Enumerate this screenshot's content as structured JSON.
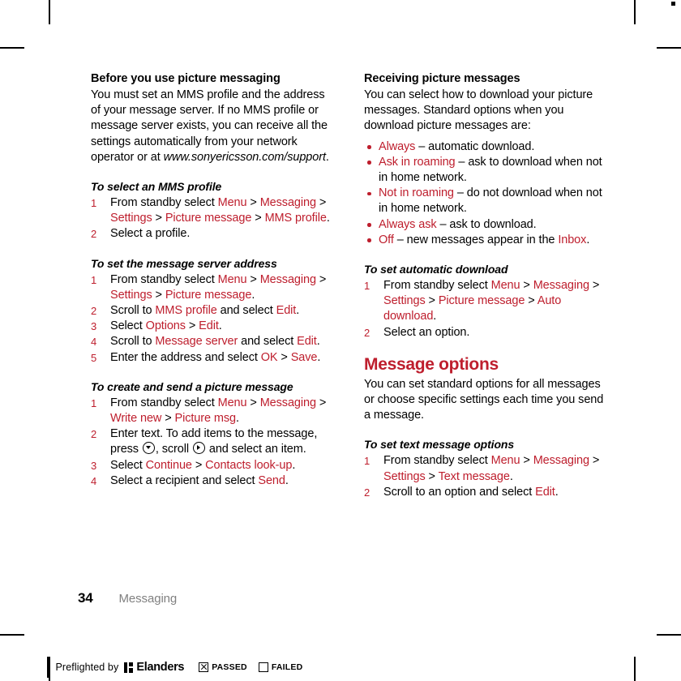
{
  "page": {
    "folio": "34",
    "section_label": "Messaging"
  },
  "left_column": {
    "intro": {
      "heading": "Before you use picture messaging",
      "body_prefix": "You must set an MMS profile and the address of your message server. If no MMS profile or message server exists, you can receive all the settings automatically from your network operator or at ",
      "body_url": "www.sonyericsson.com/support",
      "body_suffix": "."
    },
    "procedures": [
      {
        "title": "To select an MMS profile",
        "steps": [
          {
            "num": "1",
            "parts": [
              {
                "t": "From standby select ",
                "k": false
              },
              {
                "t": "Menu",
                "k": true
              },
              {
                "t": " > ",
                "k": false
              },
              {
                "t": "Messaging",
                "k": true
              },
              {
                "t": " > ",
                "k": false
              },
              {
                "t": "Settings",
                "k": true
              },
              {
                "t": " > ",
                "k": false
              },
              {
                "t": "Picture message",
                "k": true
              },
              {
                "t": " > ",
                "k": false
              },
              {
                "t": "MMS profile",
                "k": true
              },
              {
                "t": ".",
                "k": false
              }
            ]
          },
          {
            "num": "2",
            "parts": [
              {
                "t": "Select a profile.",
                "k": false
              }
            ]
          }
        ]
      },
      {
        "title": "To set the message server address",
        "steps": [
          {
            "num": "1",
            "parts": [
              {
                "t": "From standby select ",
                "k": false
              },
              {
                "t": "Menu",
                "k": true
              },
              {
                "t": " > ",
                "k": false
              },
              {
                "t": "Messaging",
                "k": true
              },
              {
                "t": " > ",
                "k": false
              },
              {
                "t": "Settings",
                "k": true
              },
              {
                "t": " > ",
                "k": false
              },
              {
                "t": "Picture message",
                "k": true
              },
              {
                "t": ".",
                "k": false
              }
            ]
          },
          {
            "num": "2",
            "parts": [
              {
                "t": "Scroll to ",
                "k": false
              },
              {
                "t": "MMS profile",
                "k": true
              },
              {
                "t": " and select ",
                "k": false
              },
              {
                "t": "Edit",
                "k": true
              },
              {
                "t": ".",
                "k": false
              }
            ]
          },
          {
            "num": "3",
            "parts": [
              {
                "t": "Select ",
                "k": false
              },
              {
                "t": "Options",
                "k": true
              },
              {
                "t": " > ",
                "k": false
              },
              {
                "t": "Edit",
                "k": true
              },
              {
                "t": ".",
                "k": false
              }
            ]
          },
          {
            "num": "4",
            "parts": [
              {
                "t": "Scroll to ",
                "k": false
              },
              {
                "t": "Message server",
                "k": true
              },
              {
                "t": " and select ",
                "k": false
              },
              {
                "t": "Edit",
                "k": true
              },
              {
                "t": ".",
                "k": false
              }
            ]
          },
          {
            "num": "5",
            "parts": [
              {
                "t": "Enter the address and select ",
                "k": false
              },
              {
                "t": "OK",
                "k": true
              },
              {
                "t": " > ",
                "k": false
              },
              {
                "t": "Save",
                "k": true
              },
              {
                "t": ".",
                "k": false
              }
            ]
          }
        ]
      },
      {
        "title": "To create and send a picture message",
        "steps": [
          {
            "num": "1",
            "parts": [
              {
                "t": "From standby select ",
                "k": false
              },
              {
                "t": "Menu",
                "k": true
              },
              {
                "t": " > ",
                "k": false
              },
              {
                "t": "Messaging",
                "k": true
              },
              {
                "t": " > ",
                "k": false
              },
              {
                "t": "Write new",
                "k": true
              },
              {
                "t": " > ",
                "k": false
              },
              {
                "t": "Picture msg",
                "k": true
              },
              {
                "t": ".",
                "k": false
              }
            ]
          },
          {
            "num": "2",
            "parts": [
              {
                "t": "Enter text. To add items to the message, press ",
                "k": false
              },
              {
                "icon": "navkey-down-icon"
              },
              {
                "t": ", scroll ",
                "k": false
              },
              {
                "icon": "navkey-right-icon"
              },
              {
                "t": " and select an item.",
                "k": false
              }
            ]
          },
          {
            "num": "3",
            "parts": [
              {
                "t": "Select ",
                "k": false
              },
              {
                "t": "Continue",
                "k": true
              },
              {
                "t": " > ",
                "k": false
              },
              {
                "t": "Contacts look-up",
                "k": true
              },
              {
                "t": ".",
                "k": false
              }
            ]
          },
          {
            "num": "4",
            "parts": [
              {
                "t": "Select a recipient and select ",
                "k": false
              },
              {
                "t": "Send",
                "k": true
              },
              {
                "t": ".",
                "k": false
              }
            ]
          }
        ]
      }
    ]
  },
  "right_column": {
    "receiving": {
      "heading": "Receiving picture messages",
      "body": "You can select how to download your picture messages. Standard options when you download picture messages are:"
    },
    "options": [
      {
        "parts": [
          {
            "t": "Always",
            "k": true
          },
          {
            "t": " – automatic download.",
            "k": false
          }
        ]
      },
      {
        "parts": [
          {
            "t": "Ask in roaming",
            "k": true
          },
          {
            "t": " – ask to download when not in home network.",
            "k": false
          }
        ]
      },
      {
        "parts": [
          {
            "t": "Not in roaming",
            "k": true
          },
          {
            "t": " – do not download when not in home network.",
            "k": false
          }
        ]
      },
      {
        "parts": [
          {
            "t": "Always ask",
            "k": true
          },
          {
            "t": " – ask to download.",
            "k": false
          }
        ]
      },
      {
        "parts": [
          {
            "t": "Off",
            "k": true
          },
          {
            "t": " – new messages appear in the ",
            "k": false
          },
          {
            "t": "Inbox",
            "k": true
          },
          {
            "t": ".",
            "k": false
          }
        ]
      }
    ],
    "auto_download": {
      "title": "To set automatic download",
      "steps": [
        {
          "num": "1",
          "parts": [
            {
              "t": "From standby select ",
              "k": false
            },
            {
              "t": "Menu",
              "k": true
            },
            {
              "t": " > ",
              "k": false
            },
            {
              "t": "Messaging",
              "k": true
            },
            {
              "t": " > ",
              "k": false
            },
            {
              "t": "Settings",
              "k": true
            },
            {
              "t": " > ",
              "k": false
            },
            {
              "t": "Picture message",
              "k": true
            },
            {
              "t": " > ",
              "k": false
            },
            {
              "t": "Auto download",
              "k": true
            },
            {
              "t": ".",
              "k": false
            }
          ]
        },
        {
          "num": "2",
          "parts": [
            {
              "t": "Select an option.",
              "k": false
            }
          ]
        }
      ]
    },
    "message_options": {
      "heading": "Message options",
      "body": "You can set standard options for all messages or choose specific settings each time you send a message."
    },
    "text_options": {
      "title": "To set text message options",
      "steps": [
        {
          "num": "1",
          "parts": [
            {
              "t": "From standby select ",
              "k": false
            },
            {
              "t": "Menu",
              "k": true
            },
            {
              "t": " > ",
              "k": false
            },
            {
              "t": "Messaging",
              "k": true
            },
            {
              "t": " > ",
              "k": false
            },
            {
              "t": "Settings",
              "k": true
            },
            {
              "t": " > ",
              "k": false
            },
            {
              "t": "Text message",
              "k": true
            },
            {
              "t": ".",
              "k": false
            }
          ]
        },
        {
          "num": "2",
          "parts": [
            {
              "t": "Scroll to an option and select ",
              "k": false
            },
            {
              "t": "Edit",
              "k": true
            },
            {
              "t": ".",
              "k": false
            }
          ]
        }
      ]
    }
  },
  "preflight": {
    "text": "Preflighted by",
    "brand": "Elanders",
    "passed_label": "PASSED",
    "failed_label": "FAILED",
    "passed_checked": true,
    "failed_checked": false
  },
  "colors": {
    "accent_red": "#be1e2d",
    "folio_gray": "#808080"
  }
}
